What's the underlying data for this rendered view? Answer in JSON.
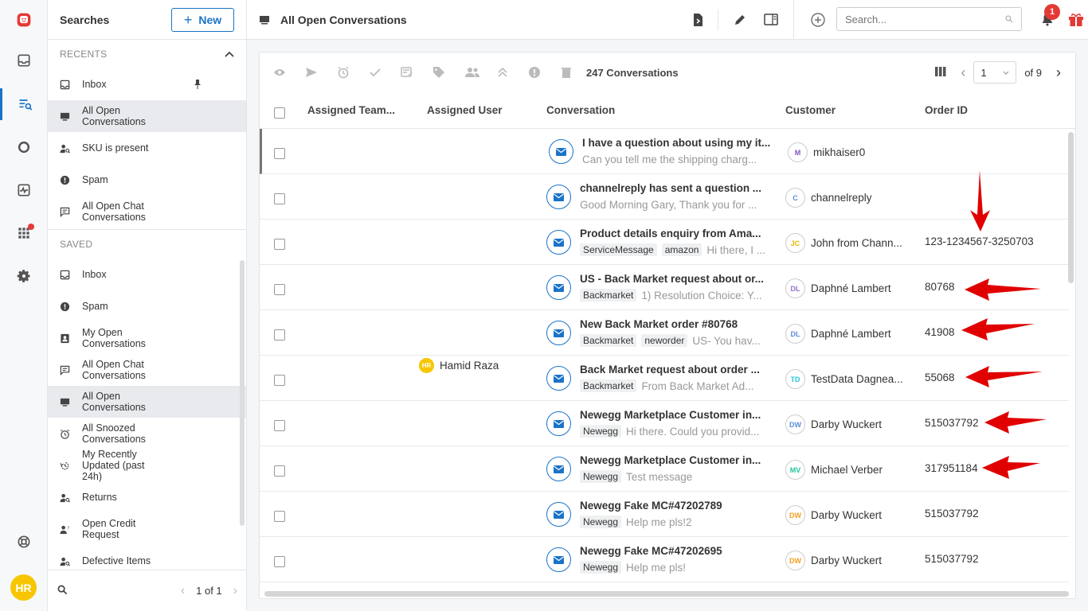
{
  "searches_panel": {
    "title": "Searches",
    "new_label": "New",
    "recents_label": "RECENTS",
    "recents": [
      {
        "label": "Inbox",
        "icon": "inbox-icon",
        "pinned": true
      },
      {
        "label": "All Open Conversations",
        "icon": "monitor-icon",
        "selected": true
      },
      {
        "label": "SKU is present",
        "icon": "user-search-icon"
      },
      {
        "label": "Spam",
        "icon": "alert-circle-icon"
      },
      {
        "label": "All Open Chat Conversations",
        "icon": "chat-icon"
      }
    ],
    "saved_label": "SAVED",
    "saved": [
      {
        "label": "Inbox",
        "icon": "inbox-icon"
      },
      {
        "label": "Spam",
        "icon": "alert-circle-icon"
      },
      {
        "label": "My Open Conversations",
        "icon": "contact-card-icon"
      },
      {
        "label": "All Open Chat Conversations",
        "icon": "chat-icon"
      },
      {
        "label": "All Open Conversations",
        "icon": "monitor-icon",
        "selected": true
      },
      {
        "label": "All Snoozed Conversations",
        "icon": "alarm-icon"
      },
      {
        "label": "My Recently Updated (past 24h)",
        "icon": "history-icon"
      },
      {
        "label": "Returns",
        "icon": "user-search-icon"
      },
      {
        "label": "Open Credit Request",
        "icon": "user-question-icon"
      },
      {
        "label": "Defective Items",
        "icon": "user-search-icon"
      }
    ],
    "footer_page": "1 of 1"
  },
  "topbar": {
    "view_title": "All Open Conversations",
    "search_placeholder": "Search...",
    "notification_count": "1"
  },
  "user_initials": "HR",
  "list": {
    "count_label": "247 Conversations",
    "page_value": "1",
    "page_total": "of 9",
    "columns": [
      "Assigned Team...",
      "Assigned User",
      "Conversation",
      "Customer",
      "Order ID"
    ],
    "rows": [
      {
        "subject": "I have a question about using my it...",
        "tags": [],
        "snippet": "Can you tell me the shipping charg...",
        "customer": "mikhaiser0",
        "initials": "M",
        "av_color": "#7e57c2",
        "order": "",
        "assigned_user": ""
      },
      {
        "subject": "channelreply has sent a question ...",
        "tags": [],
        "snippet": "Good Morning Gary, Thank you for ...",
        "customer": "channelreply",
        "initials": "C",
        "av_color": "#5c8fd6",
        "order": "",
        "assigned_user": ""
      },
      {
        "subject": "Product details enquiry from Ama...",
        "tags": [
          "ServiceMessage",
          "amazon"
        ],
        "snippet": "Hi there, I ...",
        "customer": "John from Chann...",
        "initials": "JC",
        "av_color": "#e6b800",
        "order": "123-1234567-3250703",
        "assigned_user": ""
      },
      {
        "subject": "US - Back Market request about or...",
        "tags": [
          "Backmarket"
        ],
        "snippet": "1) Resolution Choice: Y...",
        "customer": "Daphné Lambert",
        "initials": "DL",
        "av_color": "#9575cd",
        "order": "80768",
        "assigned_user": ""
      },
      {
        "subject": "New Back Market order #80768",
        "tags": [
          "Backmarket",
          "neworder"
        ],
        "snippet": "US- You hav...",
        "customer": "Daphné Lambert",
        "initials": "DL",
        "av_color": "#5c8fd6",
        "order": "41908",
        "assigned_user": ""
      },
      {
        "subject": "Back Market request about order ...",
        "tags": [
          "Backmarket"
        ],
        "snippet": "From Back Market Ad...",
        "customer": "TestData Dagnea...",
        "initials": "TD",
        "av_color": "#26c6da",
        "order": "55068",
        "assigned_user": "Hamid Raza",
        "user_initials": "HR"
      },
      {
        "subject": "Newegg Marketplace Customer in...",
        "tags": [
          "Newegg"
        ],
        "snippet": "Hi there. Could you provid...",
        "customer": "Darby Wuckert",
        "initials": "DW",
        "av_color": "#5c8fd6",
        "order": "515037792",
        "assigned_user": ""
      },
      {
        "subject": "Newegg Marketplace Customer in...",
        "tags": [
          "Newegg"
        ],
        "snippet": "Test message",
        "customer": "Michael Verber",
        "initials": "MV",
        "av_color": "#26c6a0",
        "order": "317951184",
        "assigned_user": ""
      },
      {
        "subject": "Newegg Fake MC#47202789",
        "tags": [
          "Newegg"
        ],
        "snippet": "Help me pls!2",
        "customer": "Darby Wuckert",
        "initials": "DW",
        "av_color": "#f0a020",
        "order": "515037792",
        "assigned_user": ""
      },
      {
        "subject": "Newegg Fake MC#47202695",
        "tags": [
          "Newegg"
        ],
        "snippet": "Help me pls!",
        "customer": "Darby Wuckert",
        "initials": "DW",
        "av_color": "#f0a020",
        "order": "515037792",
        "assigned_user": ""
      }
    ]
  },
  "colors": {
    "accent": "#1a73c8",
    "annotation_arrow": "#e00000"
  }
}
